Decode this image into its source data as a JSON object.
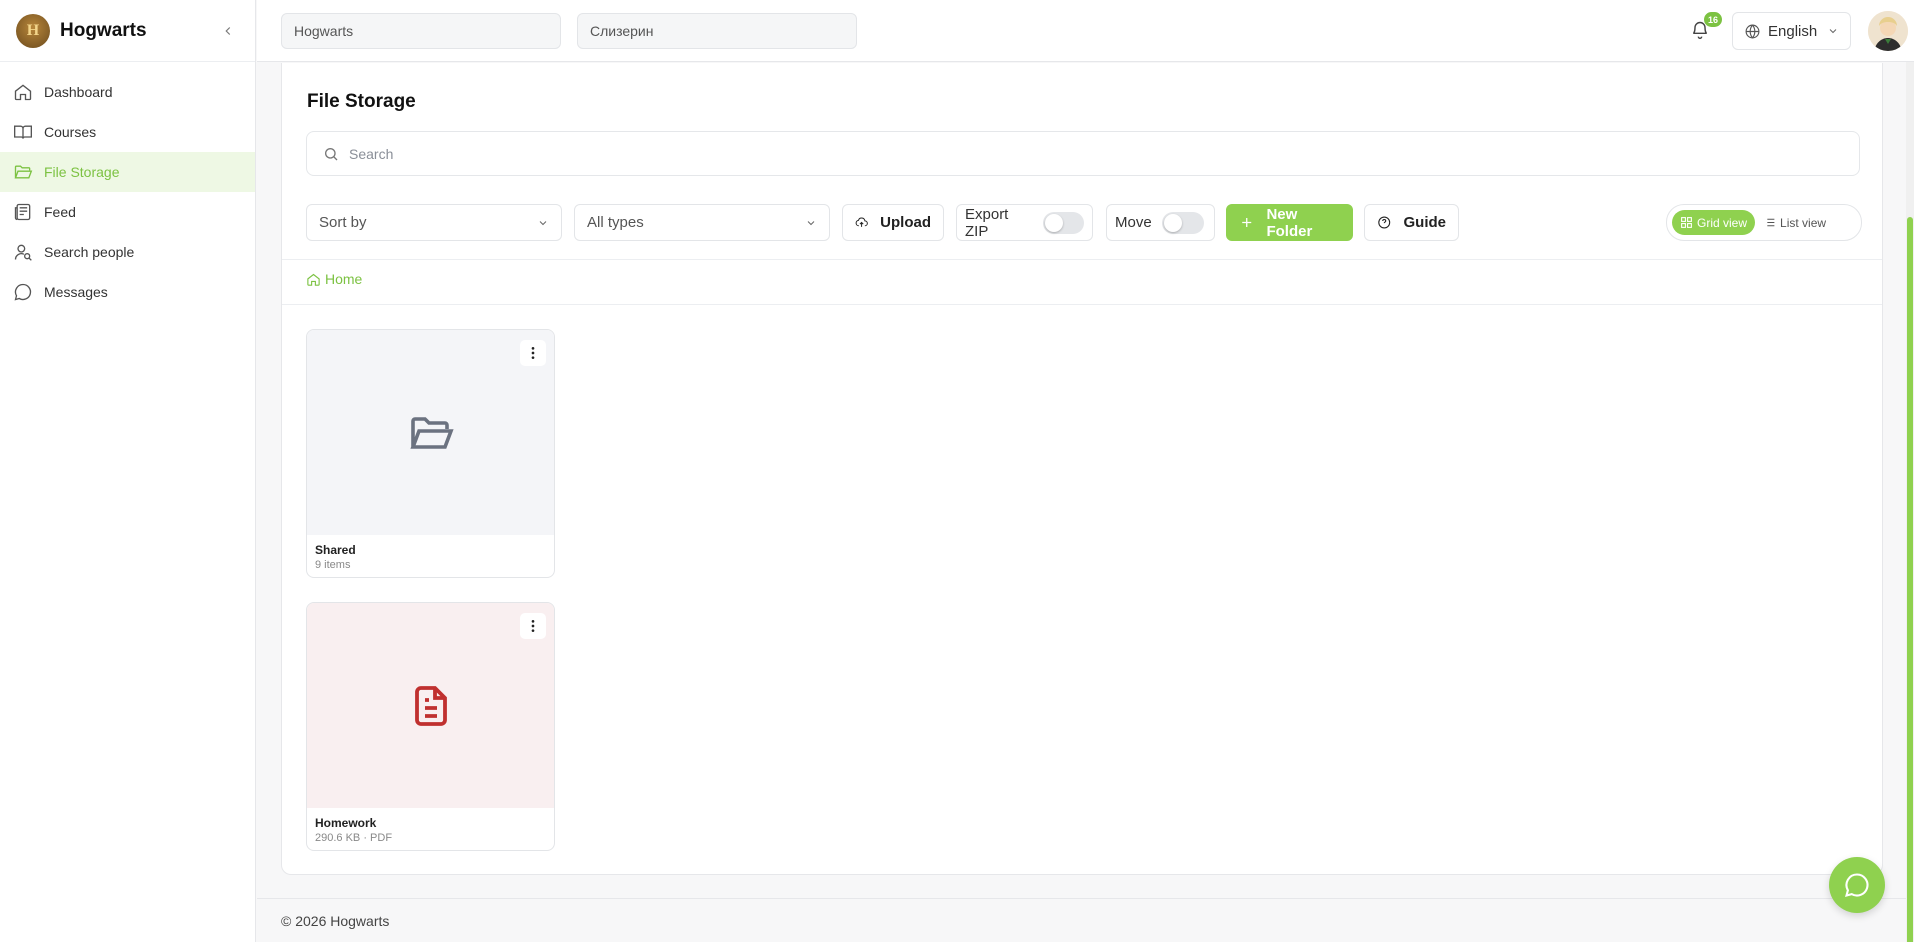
{
  "app": {
    "name": "Hogwarts"
  },
  "sidebar": {
    "items": [
      {
        "label": "Dashboard",
        "icon": "home-icon"
      },
      {
        "label": "Courses",
        "icon": "book-icon"
      },
      {
        "label": "File Storage",
        "icon": "folder-open-icon",
        "active": true
      },
      {
        "label": "Feed",
        "icon": "newspaper-icon"
      },
      {
        "label": "Search people",
        "icon": "user-search-icon"
      },
      {
        "label": "Messages",
        "icon": "chat-icon"
      }
    ]
  },
  "header": {
    "school_value": "Hogwarts",
    "house_value": "Слизерин",
    "notifications_count": "16",
    "language": "English"
  },
  "main": {
    "title": "File Storage",
    "search_placeholder": "Search",
    "sort_label": "Sort by",
    "type_label": "All types",
    "upload_label": "Upload",
    "export_zip_label": "Export ZIP",
    "move_label": "Move",
    "new_folder_label": "New Folder",
    "guide_label": "Guide",
    "grid_view_label": "Grid view",
    "list_view_label": "List view",
    "breadcrumb_home": "Home",
    "items": [
      {
        "name": "Shared",
        "meta": "9 items",
        "type": "folder"
      },
      {
        "name": "Homework",
        "meta": "290.6 KB · PDF",
        "type": "pdf"
      }
    ]
  },
  "footer": {
    "copyright": "© 2026 Hogwarts"
  },
  "colors": {
    "accent": "#8fd14f",
    "accent_text": "#7cc242",
    "pdf_red": "#c0302f"
  }
}
